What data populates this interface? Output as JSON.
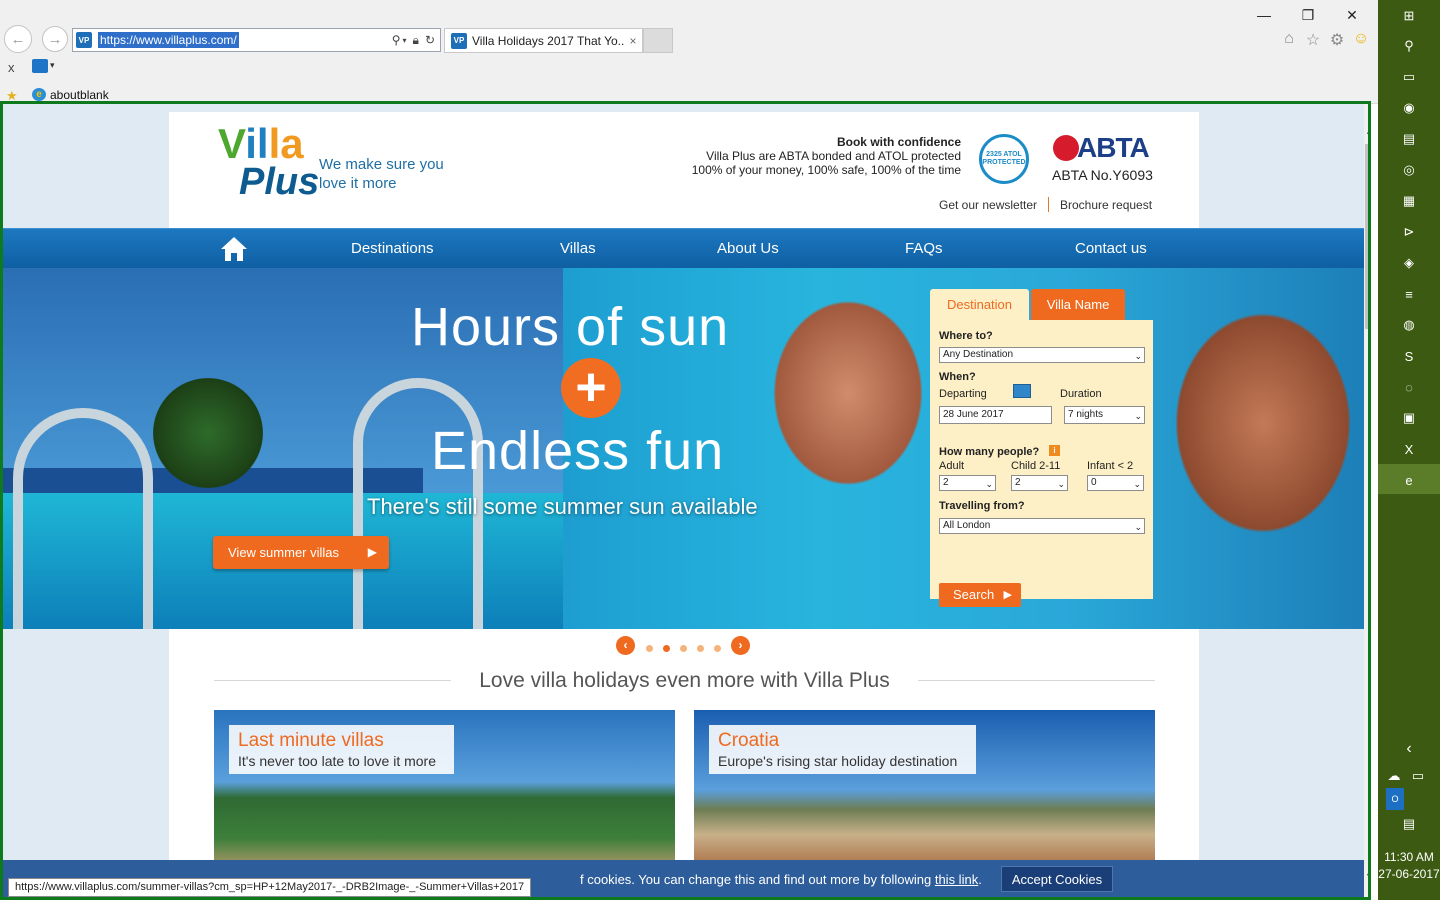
{
  "browser": {
    "url": "https://www.villaplus.com/",
    "tab_title": "Villa Holidays 2017 That Yo...",
    "tab_close": "×",
    "cmd_close": "x",
    "favorites_link": "aboutblank",
    "window_controls": {
      "minimize": "—",
      "restore": "❐",
      "close": "✕"
    }
  },
  "header": {
    "logo_villa": "Villa",
    "logo_plus": "Plus",
    "tagline": "We make sure you love it more",
    "confidence_title": "Book with confidence",
    "confidence_line1": "Villa Plus are ABTA bonded and ATOL protected",
    "confidence_line2": "100% of your money, 100% safe, 100% of the time",
    "atol_badge": "2325 ATOL PROTECTED",
    "abta_logo": "ABTA",
    "abta_number": "ABTA No.Y6093",
    "newsletter_link": "Get our newsletter",
    "brochure_link": "Brochure request"
  },
  "nav": {
    "home_icon": "home-icon",
    "items": [
      "Destinations",
      "Villas",
      "About Us",
      "FAQs",
      "Contact us"
    ]
  },
  "hero": {
    "headline1": "Hours of sun",
    "plus": "+",
    "headline2": "Endless fun",
    "subline": "There's still some summer sun available",
    "cta": "View summer villas",
    "cta_arrow": "▶"
  },
  "search": {
    "tab_destination": "Destination",
    "tab_villa_name": "Villa Name",
    "where_label": "Where to?",
    "where_value": "Any Destination",
    "when_label": "When?",
    "departing_label": "Departing",
    "departing_value": "28 June 2017",
    "duration_label": "Duration",
    "duration_value": "7 nights",
    "people_label": "How many people?",
    "adult_label": "Adult",
    "adult_value": "2",
    "child_label": "Child 2-11",
    "child_value": "2",
    "infant_label": "Infant < 2",
    "infant_value": "0",
    "from_label": "Travelling from?",
    "from_value": "All London",
    "search_button": "Search",
    "caret": "⌄",
    "info": "i"
  },
  "carousel": {
    "prev": "‹",
    "next": "›",
    "slides": 5,
    "active_index": 1
  },
  "section": {
    "title": "Love villa holidays even more with Villa Plus",
    "cards": [
      {
        "title": "Last minute villas",
        "subtitle": "It's never too late to love it more"
      },
      {
        "title": "Croatia",
        "subtitle": "Europe's rising star holiday destination"
      }
    ]
  },
  "cookie": {
    "text_before": "f cookies. You can change this and find out more by following ",
    "link": "this link",
    "text_after": ".",
    "accept_button": "Accept Cookies"
  },
  "status_url": "https://www.villaplus.com/summer-villas?cm_sp=HP+12May2017-_-DRB2Image-_-Summer+Villas+2017",
  "taskbar": {
    "time": "11:30 AM",
    "date": "27-06-2017",
    "icons": [
      "windows-icon",
      "search-icon",
      "task-view-icon",
      "paint-icon",
      "file-explorer-icon",
      "chrome-icon",
      "calculator-icon",
      "visual-studio-icon",
      "chat-icon",
      "media-icon",
      "firefox-icon",
      "skype-icon",
      "globe-icon",
      "remote-desktop-icon",
      "excel-icon",
      "internet-explorer-icon"
    ],
    "glyphs": [
      "⊞",
      "⚲",
      "▭",
      "◉",
      "▤",
      "◎",
      "▦",
      "⊳",
      "◈",
      "≡",
      "◍",
      "S",
      "◌",
      "▣",
      "X",
      "e"
    ]
  },
  "colors": {
    "brand_orange": "#ef6a1f",
    "nav_blue": "#1466ab",
    "cookie_blue": "#2d5d9a",
    "taskbar_green": "#3c5a12"
  }
}
